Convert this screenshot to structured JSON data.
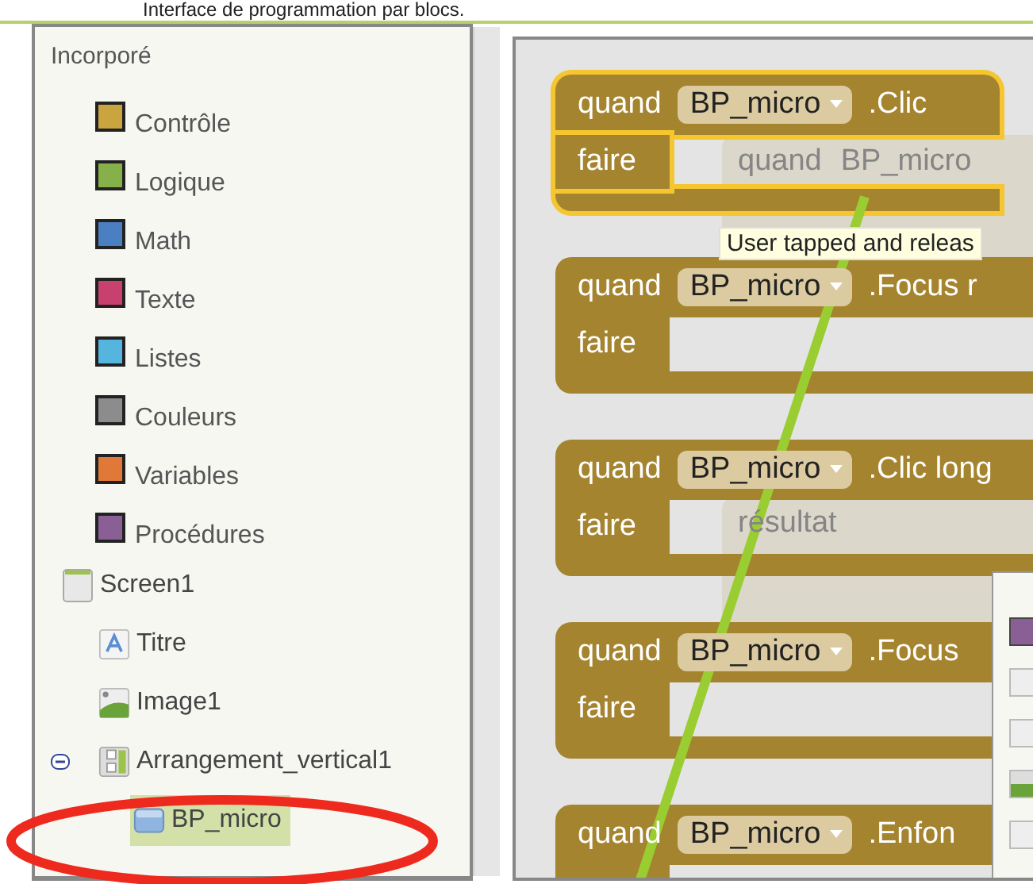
{
  "header": {
    "title": "Interface de programmation par blocs."
  },
  "palette": {
    "title": "Incorporé",
    "items": [
      {
        "label": "Contrôle",
        "color": "#c9a43f"
      },
      {
        "label": "Logique",
        "color": "#86b04a"
      },
      {
        "label": "Math",
        "color": "#4a7fc1"
      },
      {
        "label": "Texte",
        "color": "#c8406e"
      },
      {
        "label": "Listes",
        "color": "#55b5de"
      },
      {
        "label": "Couleurs",
        "color": "#8c8c8c"
      },
      {
        "label": "Variables",
        "color": "#e07838"
      },
      {
        "label": "Procédures",
        "color": "#8a5f96"
      }
    ]
  },
  "components": [
    {
      "label": "Screen1",
      "kind": "screen",
      "selected": false,
      "children": [
        {
          "label": "Titre",
          "kind": "label",
          "selected": false
        },
        {
          "label": "Image1",
          "kind": "image",
          "selected": false
        },
        {
          "label": "Arrangement_vertical1",
          "kind": "arrangement",
          "selected": false,
          "expanded": true,
          "children": [
            {
              "label": "BP_micro",
              "kind": "button",
              "selected": true
            }
          ]
        }
      ]
    }
  ],
  "workspace": {
    "ghost_blocks": [
      {
        "rows": [
          [
            "quand",
            "BP_micro"
          ]
        ]
      },
      {
        "rows": [
          [
            "résultat"
          ]
        ]
      }
    ],
    "blocks": [
      {
        "keyword": "quand",
        "component": "BP_micro",
        "event": ".Clic",
        "body_label": "faire",
        "selected": true
      },
      {
        "keyword": "quand",
        "component": "BP_micro",
        "event": ".Focus r",
        "body_label": "faire",
        "selected": false
      },
      {
        "keyword": "quand",
        "component": "BP_micro",
        "event": ".Clic long",
        "body_label": "faire",
        "selected": false
      },
      {
        "keyword": "quand",
        "component": "BP_micro",
        "event": ".Focus",
        "body_label": "faire",
        "selected": false
      },
      {
        "keyword": "quand",
        "component": "BP_micro",
        "event": ".Enfon",
        "selected": false
      }
    ],
    "tooltip": "User tapped and releas"
  }
}
